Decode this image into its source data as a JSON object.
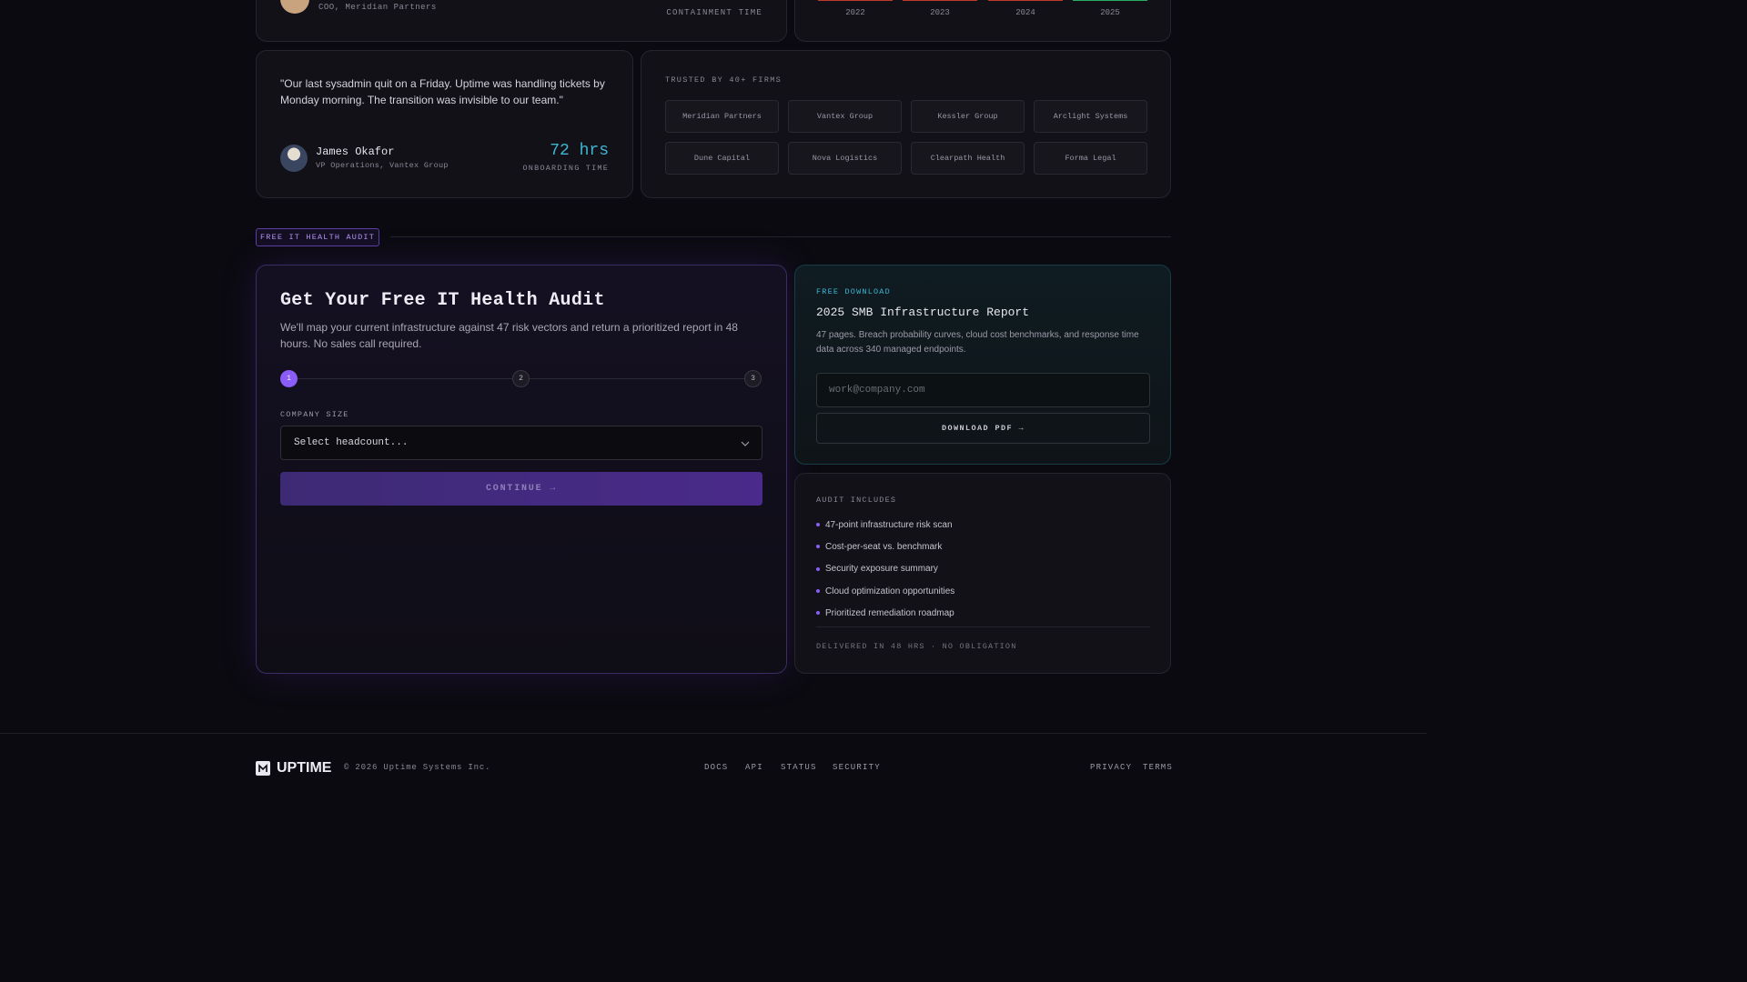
{
  "top_left": {
    "role": "COO, Meridian Partners",
    "metric_label": "CONTAINMENT TIME"
  },
  "top_right": {
    "years": [
      "2022",
      "2023",
      "2024",
      "2025"
    ],
    "bar_colors": [
      "#c0392b",
      "#c0392b",
      "#c0392b",
      "#27ae60"
    ]
  },
  "testimonial": {
    "quote": "\"Our last sysadmin quit on a Friday. Uptime was handling tickets by Monday morning. The transition was invisible to our team.\"",
    "name": "James Okafor",
    "role": "VP Operations, Vantex Group",
    "metric_value": "72 hrs",
    "metric_label": "ONBOARDING TIME"
  },
  "trusted": {
    "label": "TRUSTED BY 40+ FIRMS",
    "firms": [
      "Meridian Partners",
      "Vantex Group",
      "Kessler Group",
      "Arclight Systems",
      "Dune Capital",
      "Nova Logistics",
      "Clearpath Health",
      "Forma Legal"
    ]
  },
  "section_tag": "FREE IT HEALTH AUDIT",
  "audit": {
    "title": "Get Your Free IT Health Audit",
    "description": "We'll map your current infrastructure against 47 risk vectors and return a prioritized report in 48 hours. No sales call required.",
    "steps": [
      "1",
      "2",
      "3"
    ],
    "active_step": 1,
    "field_label": "COMPANY SIZE",
    "select_value": "Select headcount...",
    "continue_label": "CONTINUE →"
  },
  "report": {
    "eyebrow": "FREE DOWNLOAD",
    "title": "2025 SMB Infrastructure Report",
    "description": "47 pages. Breach probability curves, cloud cost benchmarks, and response time data across 340 managed endpoints.",
    "email_placeholder": "work@company.com",
    "download_label": "DOWNLOAD PDF →"
  },
  "includes": {
    "label": "AUDIT INCLUDES",
    "items": [
      "47-point infrastructure risk scan",
      "Cost-per-seat vs. benchmark",
      "Security exposure summary",
      "Cloud optimization opportunities",
      "Prioritized remediation roadmap"
    ],
    "footer_note": "DELIVERED IN 48 HRS · NO OBLIGATION"
  },
  "footer": {
    "brand": "UPTIME",
    "copyright": "© 2026 Uptime Systems Inc.",
    "links": [
      "DOCS",
      "API",
      "STATUS",
      "SECURITY"
    ],
    "legal": [
      "PRIVACY",
      "TERMS"
    ]
  },
  "colors": {
    "accent_purple": "#8b5cf6",
    "accent_cyan": "#3fb7d4"
  }
}
